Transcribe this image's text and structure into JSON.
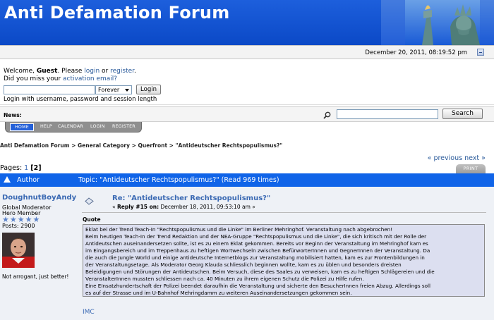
{
  "header": {
    "title": "Anti Defamation Forum"
  },
  "datebar": {
    "date": "December 20, 2011, 08:19:52 pm"
  },
  "user_panel": {
    "welcome_prefix": "Welcome, ",
    "guest": "Guest",
    "welcome_mid": ". Please ",
    "login_link": "login",
    "or": " or ",
    "register_link": "register",
    "period": ".",
    "miss_prefix": "Did you miss your ",
    "activation_link": "activation email?",
    "session_value": "Forever",
    "login_button": "Login",
    "login_hint": "Login with username, password and session length"
  },
  "newsbar": {
    "label": "News:",
    "search_button": "Search",
    "search_value": ""
  },
  "menu": {
    "tabs": [
      "HOME",
      "HELP",
      "CALENDAR",
      "LOGIN",
      "REGISTER"
    ]
  },
  "breadcrumb": {
    "items": [
      "Anti Defamation Forum",
      "General Category",
      "Querfront",
      "\"Antideutscher Rechtspopulismus?\""
    ],
    "sep": " > "
  },
  "nav": {
    "previous": "« previous",
    "next": "next »"
  },
  "pages": {
    "label": "Pages: ",
    "page1": "1",
    "current": "[2]"
  },
  "print_button": "PRINT",
  "topic_header": {
    "author": "Author",
    "topic": "Topic: \"Antideutscher Rechtspopulismus?\"  (Read 969 times)"
  },
  "post": {
    "poster_name": "DoughnutBoyAndy",
    "role": "Global Moderator",
    "rank": "Hero Member",
    "stars": "★★★★★",
    "posts": "Posts: 2900",
    "signature": "Not arrogant, just better!",
    "title": "Re: \"Antideutscher Rechtspopulismus?\"",
    "meta_prefix": "« ",
    "meta_reply": "Reply #15 on:",
    "meta_date": " December 18, 2011, 09:53:10 am »",
    "quote_label": "Quote",
    "quote_lines": [
      "Eklat bei der Trend Teach-In \"Rechtspopulismus und die Linke\" im Berliner Mehringhof. Veranstaltung nach abgebrochen!",
      "Beim heutigen Teach-In der Trend Redaktion und der NEA-Gruppe \"Rechtspopulismus und die Linke\", die sich kritisch mit der Rolle der",
      "Antideutschen auseinandersetzen sollte, ist es zu einem Eklat gekommen. Bereits vor Beginn der Veranstaltung im Mehringhof kam es",
      "im Eingangsbereich und im Treppenhaus zu heftigen Wortwechseln zwischen BefürworterInnen und GegnerInnen der Veranstaltung. Da",
      "die auch die Jungle World und einige antideutsche Internetblogs zur Veranstaltung mobilisiert hatten, kam es zur Frontenbildungen in",
      "der Veranstaltungsetage. Als Moderator Georg Klauda schliesslich beginnen wollte, kam es zu üblen und besonders dreisten",
      "Beleidigungen und Störungen der Antideutschen. Beim Versuch, diese des Saales zu verweisen, kam es zu heftigen Schlägereien und die",
      "VeranstalterInnen mussten schliessen nach ca. 40 Minuten zu ihrem eigenen Schutz die Polizei zu Hilfe rufen.",
      "Eine EInsatzhundertschaft der Polizei beendet daraufhin die Veranstaltung und sicherte den BesucherInnen freien Abzug. Allerdings soll",
      "es auf der Strasse und im U-Bahnhof Mehringdamm zu weiteren Auseinandersetzungen gekommen sein."
    ],
    "link": "IMC"
  }
}
